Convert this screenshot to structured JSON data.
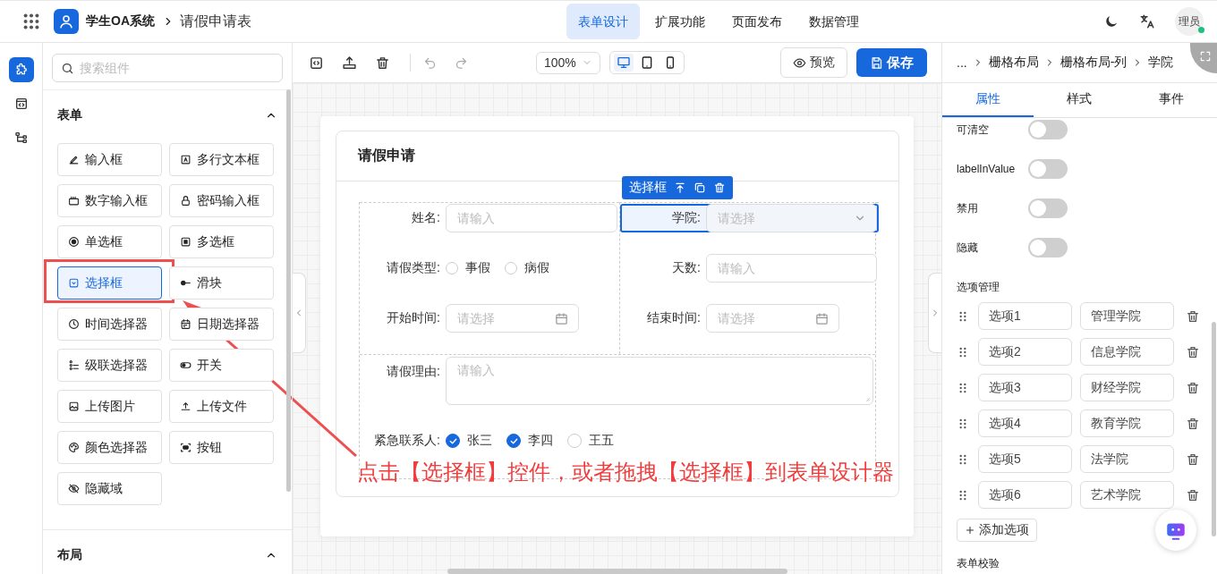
{
  "topbar": {
    "app_name": "学生OA系统",
    "page": "请假申请表",
    "nav": [
      {
        "label": "表单设计",
        "selected": true
      },
      {
        "label": "扩展功能",
        "selected": false
      },
      {
        "label": "页面发布",
        "selected": false
      },
      {
        "label": "数据管理",
        "selected": false
      }
    ],
    "avatar": {
      "text": "理员",
      "online": true
    }
  },
  "rail": [
    {
      "selected": true
    },
    {
      "selected": false
    },
    {
      "selected": false
    }
  ],
  "component_panel": {
    "search_placeholder": "搜索组件",
    "sections": [
      {
        "title": "表单",
        "expanded": true,
        "items": [
          {
            "label": "输入框",
            "selected": false
          },
          {
            "label": "多行文本框",
            "selected": false
          },
          {
            "label": "数字输入框",
            "selected": false
          },
          {
            "label": "密码输入框",
            "selected": false
          },
          {
            "label": "单选框",
            "selected": false
          },
          {
            "label": "多选框",
            "selected": false
          },
          {
            "label": "选择框",
            "selected": true
          },
          {
            "label": "滑块",
            "selected": false
          },
          {
            "label": "时间选择器",
            "selected": false
          },
          {
            "label": "日期选择器",
            "selected": false
          },
          {
            "label": "级联选择器",
            "selected": false
          },
          {
            "label": "开关",
            "selected": false
          },
          {
            "label": "上传图片",
            "selected": false
          },
          {
            "label": "上传文件",
            "selected": false
          },
          {
            "label": "颜色选择器",
            "selected": false
          },
          {
            "label": "按钮",
            "selected": false
          },
          {
            "label": "隐藏域",
            "selected": false
          }
        ]
      },
      {
        "title": "布局",
        "expanded": true
      }
    ]
  },
  "toolbar": {
    "zoom": "100%",
    "devices": [
      {
        "selected": true
      },
      {
        "selected": false
      },
      {
        "selected": false
      }
    ],
    "preview": "预览",
    "save": "保存"
  },
  "form": {
    "title": "请假申请",
    "selected_tag": "选择框",
    "grid": {
      "columns": [
        [
          {
            "kind": "input",
            "label": "姓名:",
            "placeholder": "请输入",
            "selected": false
          },
          {
            "kind": "radio",
            "label": "请假类型:",
            "options": [
              {
                "label": "事假",
                "selected": false
              },
              {
                "label": "病假",
                "selected": false
              }
            ],
            "selected": false
          },
          {
            "kind": "date",
            "label": "开始时间:",
            "placeholder": "请选择",
            "selected": false
          }
        ],
        [
          {
            "kind": "select",
            "label": "学院:",
            "placeholder": "请选择",
            "selected": true
          },
          {
            "kind": "input",
            "label": "天数:",
            "placeholder": "请输入",
            "selected": false
          },
          {
            "kind": "date",
            "label": "结束时间:",
            "placeholder": "请选择",
            "selected": false
          }
        ]
      ]
    },
    "fields": [
      {
        "kind": "textarea",
        "label": "请假理由:",
        "placeholder": "请输入",
        "selected": false
      },
      {
        "kind": "checkbox",
        "label": "紧急联系人:",
        "options": [
          {
            "label": "张三",
            "checked": true
          },
          {
            "label": "李四",
            "checked": true
          },
          {
            "label": "王五",
            "checked": false
          }
        ],
        "selected": false
      }
    ]
  },
  "properties": {
    "breadcrumb": [
      "...",
      "栅格布局",
      "栅格布局-列",
      "学院"
    ],
    "tabs": [
      {
        "label": "属性",
        "selected": true
      },
      {
        "label": "样式",
        "selected": false
      },
      {
        "label": "事件",
        "selected": false
      }
    ],
    "switches": [
      {
        "label": "可清空",
        "on": false
      },
      {
        "label": "labelInValue",
        "on": false
      },
      {
        "label": "禁用",
        "on": false
      },
      {
        "label": "隐藏",
        "on": false
      }
    ],
    "options_title": "选项管理",
    "options": [
      {
        "key": "选项1",
        "value": "管理学院"
      },
      {
        "key": "选项2",
        "value": "信息学院"
      },
      {
        "key": "选项3",
        "value": "财经学院"
      },
      {
        "key": "选项4",
        "value": "教育学院"
      },
      {
        "key": "选项5",
        "value": "法学院"
      },
      {
        "key": "选项6",
        "value": "艺术学院"
      }
    ],
    "add_option": "添加选项",
    "validation_title": "表单校验"
  },
  "annotation": {
    "text": "点击【选择框】控件，或者拖拽【选择框】到表单设计器"
  }
}
